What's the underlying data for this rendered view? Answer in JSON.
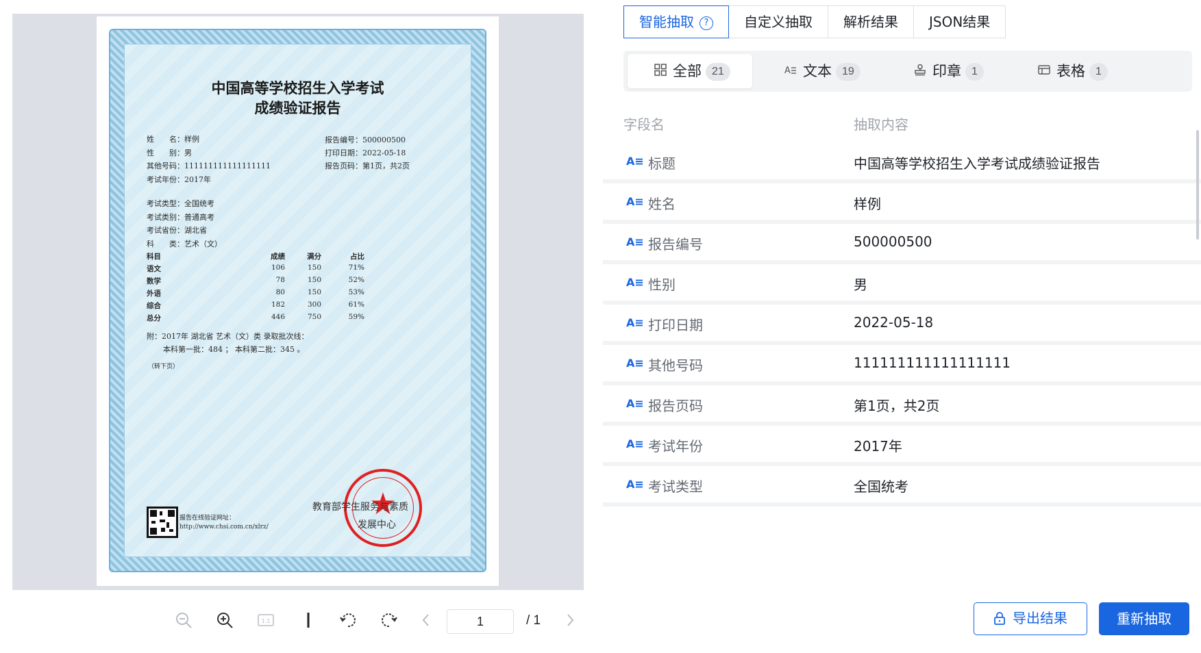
{
  "viewer": {
    "certificate": {
      "title_line1": "中国高等学校招生入学考试",
      "title_line2": "成绩验证报告",
      "name_line": "姓　　名：样例",
      "gender_line": "性　　别：男",
      "other_no_line": "其他号码：111111111111111111",
      "year_line": "考试年份：2017年",
      "report_no_line": "报告编号：500000500",
      "print_date_line": "打印日期：2022-05-18",
      "page_line": "报告页码：第1页，共2页",
      "exam_type_line": "考试类型：全国统考",
      "exam_cat_line": "考试类别：普通高考",
      "province_line": "考试省份：湖北省",
      "subject_cat_line": "科　　类：艺术（文）",
      "table_header": [
        "科目",
        "成绩",
        "满分",
        "占比"
      ],
      "table_rows": [
        [
          "语文",
          "106",
          "150",
          "71%"
        ],
        [
          "数学",
          "78",
          "150",
          "52%"
        ],
        [
          "外语",
          "80",
          "150",
          "53%"
        ],
        [
          "综合",
          "182",
          "300",
          "61%"
        ],
        [
          "总分",
          "446",
          "750",
          "59%"
        ]
      ],
      "note_line1": "附：2017年 湖北省 艺术（文）类 录取批次线：",
      "note_line2": "本科第一批：484 ； 本科第二批：345 。",
      "continued": "（转下页）",
      "verify_label": "报告在线验证网址：",
      "verify_url": "http://www.chsi.com.cn/xlrz/",
      "issuer_line1": "教育部学生服务与素质",
      "issuer_line2": "发展中心"
    },
    "toolbar": {
      "page_value": "1",
      "page_total": "/ 1",
      "icons": [
        "zoom-out-icon",
        "zoom-in-icon",
        "actual-size-icon",
        "divider",
        "rotate-left-icon",
        "rotate-right-icon",
        "chevron-left-icon",
        "chevron-right-icon"
      ]
    }
  },
  "panel": {
    "top_tabs": [
      {
        "label": "智能抽取",
        "active": true
      },
      {
        "label": "自定义抽取",
        "active": false
      },
      {
        "label": "解析结果",
        "active": false
      },
      {
        "label": "JSON结果",
        "active": false
      }
    ],
    "filter_tabs": [
      {
        "label": "全部",
        "count": "21",
        "icon": "grid-icon"
      },
      {
        "label": "文本",
        "count": "19",
        "icon": "text-icon"
      },
      {
        "label": "印章",
        "count": "1",
        "icon": "stamp-icon"
      },
      {
        "label": "表格",
        "count": "1",
        "icon": "table-icon"
      }
    ],
    "table_head": {
      "field": "字段名",
      "content": "抽取内容"
    },
    "rows": [
      {
        "name": "标题",
        "value": "中国高等学校招生入学考试成绩验证报告"
      },
      {
        "name": "姓名",
        "value": "样例"
      },
      {
        "name": "报告编号",
        "value": "500000500"
      },
      {
        "name": "性别",
        "value": "男"
      },
      {
        "name": "打印日期",
        "value": "2022-05-18"
      },
      {
        "name": "其他号码",
        "value": "111111111111111111"
      },
      {
        "name": "报告页码",
        "value": "第1页，共2页"
      },
      {
        "name": "考试年份",
        "value": "2017年"
      },
      {
        "name": "考试类型",
        "value": "全国统考"
      }
    ],
    "export_label": "导出结果",
    "rerun_label": "重新抽取",
    "accent_color": "#1a66e0"
  }
}
